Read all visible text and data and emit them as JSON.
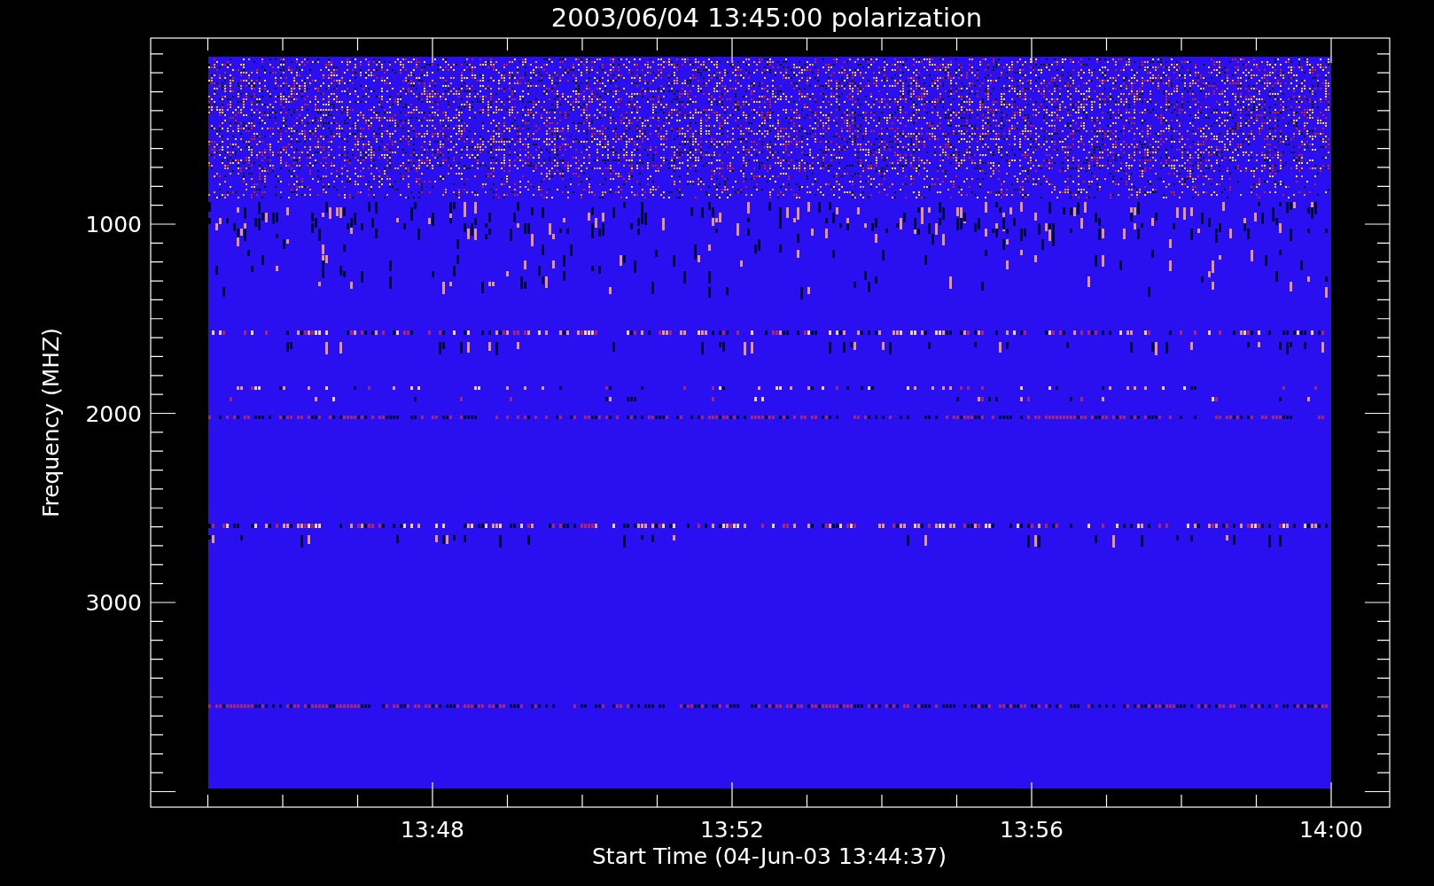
{
  "plot": {
    "title": "2003/06/04 13:45:00 polarization",
    "ylabel": "Frequency (MHZ)",
    "xlabel": "Start Time (04-Jun-03 13:44:37)",
    "y_ticks": [
      "1000",
      "2000",
      "3000"
    ],
    "x_ticks": [
      "13:48",
      "13:52",
      "13:56",
      "14:00"
    ]
  }
}
